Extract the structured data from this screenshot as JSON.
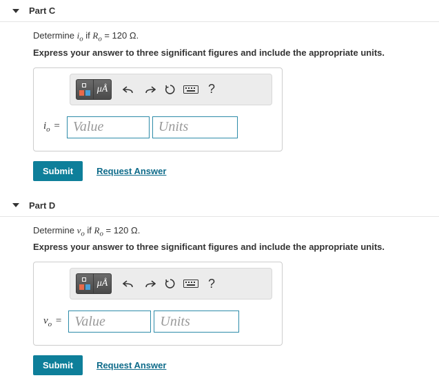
{
  "parts": [
    {
      "title": "Part C",
      "prompt_pre": "Determine ",
      "prompt_var_base": "i",
      "prompt_var_sub": "o",
      "prompt_mid": " if ",
      "prompt_cond_base": "R",
      "prompt_cond_sub": "o",
      "prompt_eq": " = 120 Ω.",
      "instruction": "Express your answer to three significant figures and include the appropriate units.",
      "toolbar": {
        "units_label": "μÅ",
        "help": "?"
      },
      "lhs_base": "i",
      "lhs_sub": "o",
      "lhs_eq": " =",
      "value_placeholder": "Value",
      "units_placeholder": "Units",
      "submit": "Submit",
      "request": "Request Answer"
    },
    {
      "title": "Part D",
      "prompt_pre": "Determine ",
      "prompt_var_base": "v",
      "prompt_var_sub": "o",
      "prompt_mid": " if ",
      "prompt_cond_base": "R",
      "prompt_cond_sub": "o",
      "prompt_eq": " = 120 Ω.",
      "instruction": "Express your answer to three significant figures and include the appropriate units.",
      "toolbar": {
        "units_label": "μÅ",
        "help": "?"
      },
      "lhs_base": "v",
      "lhs_sub": "o",
      "lhs_eq": " =",
      "value_placeholder": "Value",
      "units_placeholder": "Units",
      "submit": "Submit",
      "request": "Request Answer"
    }
  ]
}
